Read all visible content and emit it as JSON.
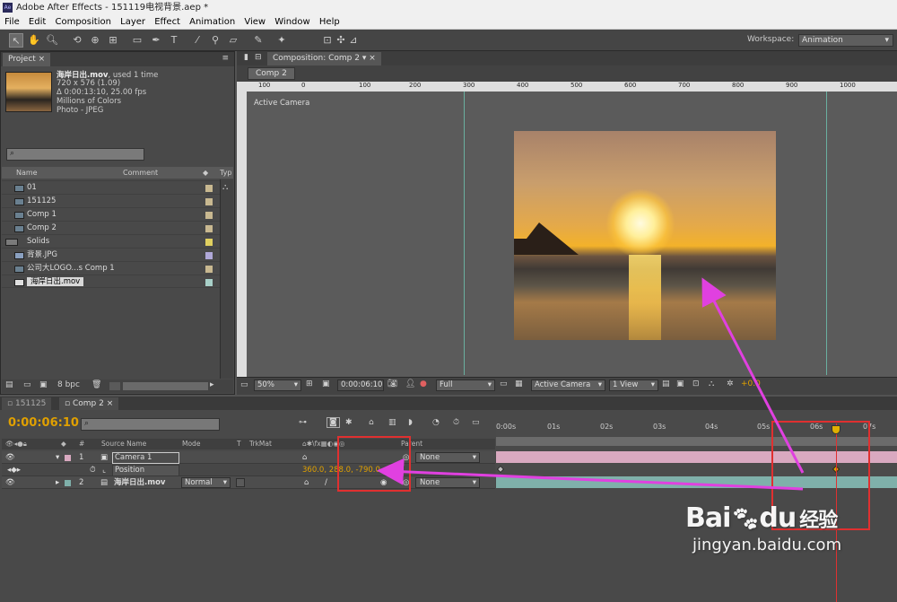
{
  "window": {
    "title": "Adobe After Effects - 151119电视背景.aep *",
    "icon": "Ae"
  },
  "menu": [
    "File",
    "Edit",
    "Composition",
    "Layer",
    "Effect",
    "Animation",
    "View",
    "Window",
    "Help"
  ],
  "toolbar": {
    "tools": [
      "selection-tool-icon",
      "hand-tool-icon",
      "zoom-tool-icon",
      "rotate-tool-icon",
      "orbit-camera-icon",
      "track-xy-icon",
      "rectangle-tool-icon",
      "pen-tool-icon",
      "type-tool-icon",
      "brush-tool-icon",
      "clone-stamp-icon",
      "eraser-icon",
      "roto-brush-icon",
      "puppet-pin-icon"
    ],
    "workspace_label": "Workspace:",
    "workspace_value": "Animation"
  },
  "project": {
    "tab": "Project",
    "selected_name": "海岸日出.mov",
    "used": ", used 1 time",
    "info": [
      "720 x 576 (1.09)",
      "Δ 0:00:13:10, 25.00 fps",
      "Millions of Colors",
      "Photo - JPEG"
    ],
    "columns": {
      "name": "Name",
      "comment": "Comment",
      "type": "Typ"
    },
    "items": [
      {
        "name": "01",
        "label_color": "#c8b890"
      },
      {
        "name": "151125",
        "label_color": "#c8b890"
      },
      {
        "name": "Comp 1",
        "label_color": "#c8b890"
      },
      {
        "name": "Comp 2",
        "label_color": "#c8b890"
      },
      {
        "name": "Solids",
        "label_color": "#e0d060"
      },
      {
        "name": "背景.JPG",
        "label_color": "#b0a8d8"
      },
      {
        "name": "公司大LOGO...s Comp 1",
        "label_color": "#c8b890"
      },
      {
        "name": "海岸日出.mov",
        "label_color": "#a8d0c8"
      }
    ],
    "bpc": "8 bpc"
  },
  "composition": {
    "tab": "Composition: Comp 2",
    "sub_tab": "Comp 2",
    "view_label": "Active Camera",
    "ruler_ticks": [
      "100",
      "0",
      "100",
      "200",
      "300",
      "400",
      "500",
      "600",
      "700",
      "800",
      "900",
      "1000"
    ],
    "footer": {
      "zoom": "50%",
      "timecode": "0:00:06:10",
      "resolution": "Full",
      "camera": "Active Camera",
      "views": "1 View",
      "exposure": "+0.0"
    }
  },
  "timeline": {
    "tabs": [
      "151125",
      "Comp 2"
    ],
    "timecode": "0:00:06:10",
    "columns": {
      "source": "Source Name",
      "mode": "Mode",
      "t": "T",
      "trkmat": "TrkMat",
      "parent": "Parent"
    },
    "layers": [
      {
        "num": "1",
        "name": "Camera 1",
        "parent": "None",
        "label_color": "#d9a9c0"
      },
      {
        "num": "2",
        "name": "海岸日出.mov",
        "mode": "Normal",
        "parent": "None",
        "label_color": "#7fb0aa"
      }
    ],
    "property": {
      "name": "Position",
      "value": "360.0, 288.0, -790.0"
    },
    "time_ticks": [
      "0:00s",
      "01s",
      "02s",
      "03s",
      "04s",
      "05s",
      "06s",
      "07s"
    ],
    "cti_time_sec": 6.4
  },
  "watermark": {
    "logo": "Bai",
    "logo2": "du",
    "logo3": "经验",
    "url": "jingyan.baidu.com"
  }
}
